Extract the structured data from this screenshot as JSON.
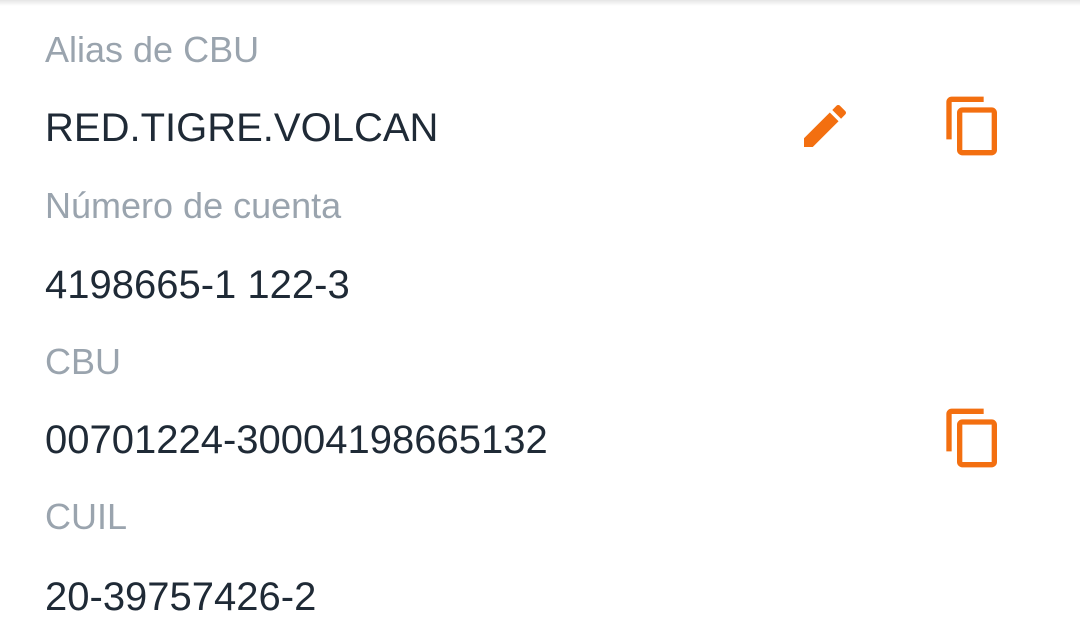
{
  "accent_color": "#f36f10",
  "fields": [
    {
      "label": "Alias de CBU",
      "value": "RED.TIGRE.VOLCAN",
      "icons": [
        "edit-icon",
        "copy-icon"
      ]
    },
    {
      "label": "Número de cuenta",
      "value": "4198665-1 122-3",
      "icons": []
    },
    {
      "label": "CBU",
      "value": "00701224-30004198665132",
      "icons": [
        "copy-icon"
      ]
    },
    {
      "label": "CUIL",
      "value": "20-39757426-2",
      "icons": []
    }
  ]
}
